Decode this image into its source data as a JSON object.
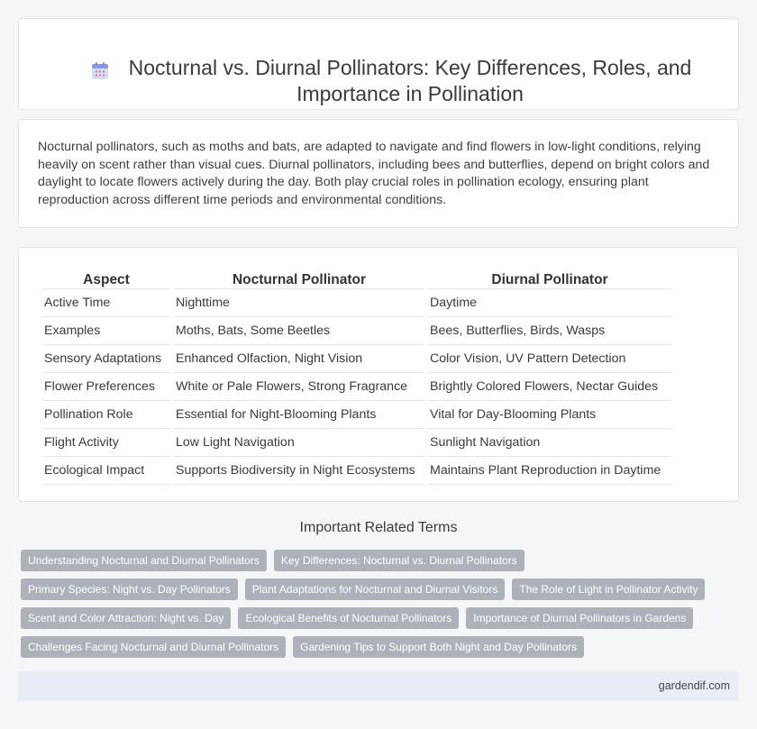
{
  "header": {
    "title": "Nocturnal vs. Diurnal Pollinators: Key Differences, Roles, and Importance in Pollination",
    "icon": "calendar-icon"
  },
  "intro": {
    "text": "Nocturnal pollinators, such as moths and bats, are adapted to navigate and find flowers in low-light conditions, relying heavily on scent rather than visual cues. Diurnal pollinators, including bees and butterflies, depend on bright colors and daylight to locate flowers actively during the day. Both play crucial roles in pollination ecology, ensuring plant reproduction across different time periods and environmental conditions."
  },
  "table": {
    "headers": [
      "Aspect",
      "Nocturnal Pollinator",
      "Diurnal Pollinator"
    ],
    "rows": [
      [
        "Active Time",
        "Nighttime",
        "Daytime"
      ],
      [
        "Examples",
        "Moths, Bats, Some Beetles",
        "Bees, Butterflies, Birds, Wasps"
      ],
      [
        "Sensory Adaptations",
        "Enhanced Olfaction, Night Vision",
        "Color Vision, UV Pattern Detection"
      ],
      [
        "Flower Preferences",
        "White or Pale Flowers, Strong Fragrance",
        "Brightly Colored Flowers, Nectar Guides"
      ],
      [
        "Pollination Role",
        "Essential for Night-Blooming Plants",
        "Vital for Day-Blooming Plants"
      ],
      [
        "Flight Activity",
        "Low Light Navigation",
        "Sunlight Navigation"
      ],
      [
        "Ecological Impact",
        "Supports Biodiversity in Night Ecosystems",
        "Maintains Plant Reproduction in Daytime"
      ]
    ]
  },
  "related": {
    "heading": "Important Related Terms",
    "rows": [
      [
        "Understanding Nocturnal and Diurnal Pollinators",
        "Key Differences: Nocturnal vs. Diurnal Pollinators"
      ],
      [
        "Primary Species: Night vs. Day Pollinators",
        "Plant Adaptations for Nocturnal and Diurnal Visitors",
        "The Role of Light in Pollinator Activity"
      ],
      [
        "Scent and Color Attraction: Night vs. Day",
        "Ecological Benefits of Nocturnal Pollinators",
        "Importance of Diurnal Pollinators in Gardens"
      ],
      [
        "Challenges Facing Nocturnal and Diurnal Pollinators",
        "Gardening Tips to Support Both Night and Day Pollinators"
      ]
    ]
  },
  "footer": {
    "site": "gardendif.com"
  },
  "colors": {
    "tag_bg": "#adb2ba",
    "footer_bg": "#e9eef6",
    "icon_accent": "#7b8cde"
  }
}
